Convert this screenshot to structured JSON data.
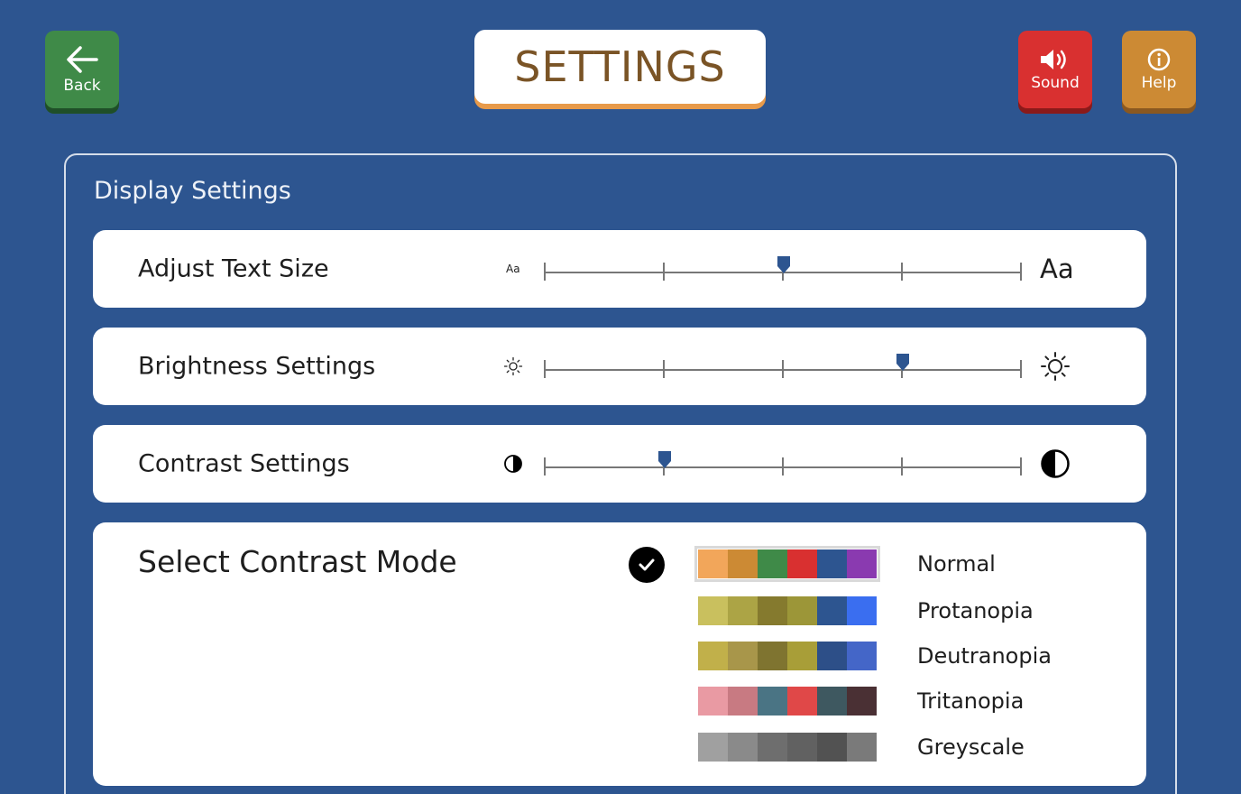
{
  "header": {
    "title": "SETTINGS",
    "back_label": "Back",
    "sound_label": "Sound",
    "help_label": "Help"
  },
  "panel": {
    "title": "Display Settings"
  },
  "sliders": [
    {
      "label": "Adjust Text Size",
      "value": 0.5,
      "min_icon": "Aa",
      "max_icon": "Aa"
    },
    {
      "label": "Brightness Settings",
      "value": 0.75,
      "min_icon": "sun-small-icon",
      "max_icon": "sun-large-icon"
    },
    {
      "label": "Contrast Settings",
      "value": 0.25,
      "min_icon": "contrast-small-icon",
      "max_icon": "contrast-large-icon"
    }
  ],
  "contrast_mode": {
    "title": "Select Contrast Mode",
    "selected": "Normal",
    "modes": [
      {
        "label": "Normal",
        "colors": [
          "#f2a65a",
          "#cc8a34",
          "#3f8a48",
          "#d93030",
          "#2d5590",
          "#8a3ab0"
        ]
      },
      {
        "label": "Protanopia",
        "colors": [
          "#c9c05e",
          "#aca445",
          "#857a2e",
          "#9c9638",
          "#2d5590",
          "#3a6ef0"
        ]
      },
      {
        "label": "Deutranopia",
        "colors": [
          "#c1b04a",
          "#a8964a",
          "#7f7430",
          "#a89e38",
          "#2d4f88",
          "#4466c8"
        ]
      },
      {
        "label": "Tritanopia",
        "colors": [
          "#e99aa3",
          "#c87a82",
          "#4a7484",
          "#e04848",
          "#3e5860",
          "#4a3034"
        ]
      },
      {
        "label": "Greyscale",
        "colors": [
          "#a0a0a0",
          "#8a8a8a",
          "#6e6e6e",
          "#616161",
          "#525252",
          "#7a7a7a"
        ]
      }
    ]
  },
  "colors": {
    "background": "#2d5590",
    "back_button": "#3f8a48",
    "sound_button": "#d93030",
    "help_button": "#cc8a34",
    "title_text": "#7a5426",
    "slider_thumb": "#2d5590"
  }
}
